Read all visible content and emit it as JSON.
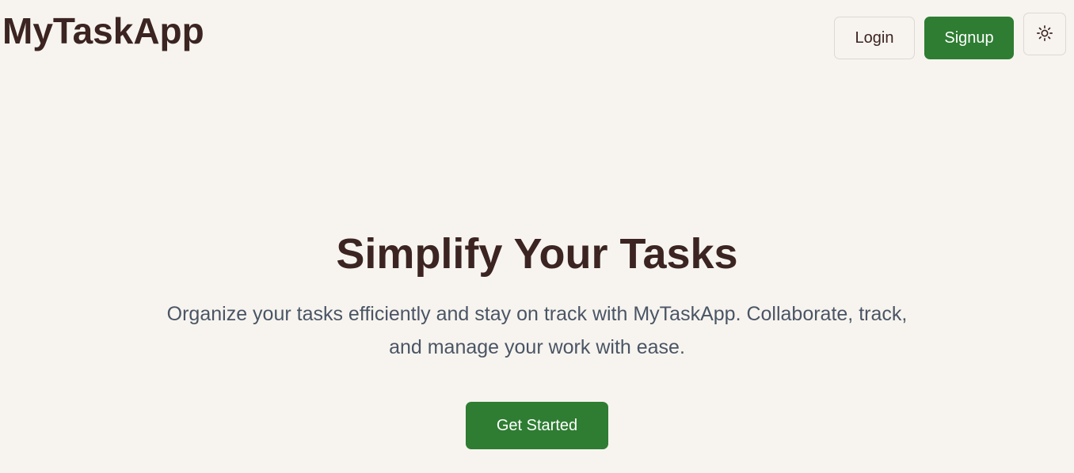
{
  "header": {
    "brand": "MyTaskApp",
    "login_label": "Login",
    "signup_label": "Signup",
    "theme_toggle_icon": "sun-icon"
  },
  "hero": {
    "title": "Simplify Your Tasks",
    "subtitle": "Organize your tasks efficiently and stay on track with MyTaskApp. Collaborate, track, and manage your work with ease.",
    "cta_label": "Get Started"
  },
  "colors": {
    "background": "#f7f4ef",
    "primary": "#2e7d32",
    "heading": "#3b2421",
    "body_text": "#4a5565"
  }
}
